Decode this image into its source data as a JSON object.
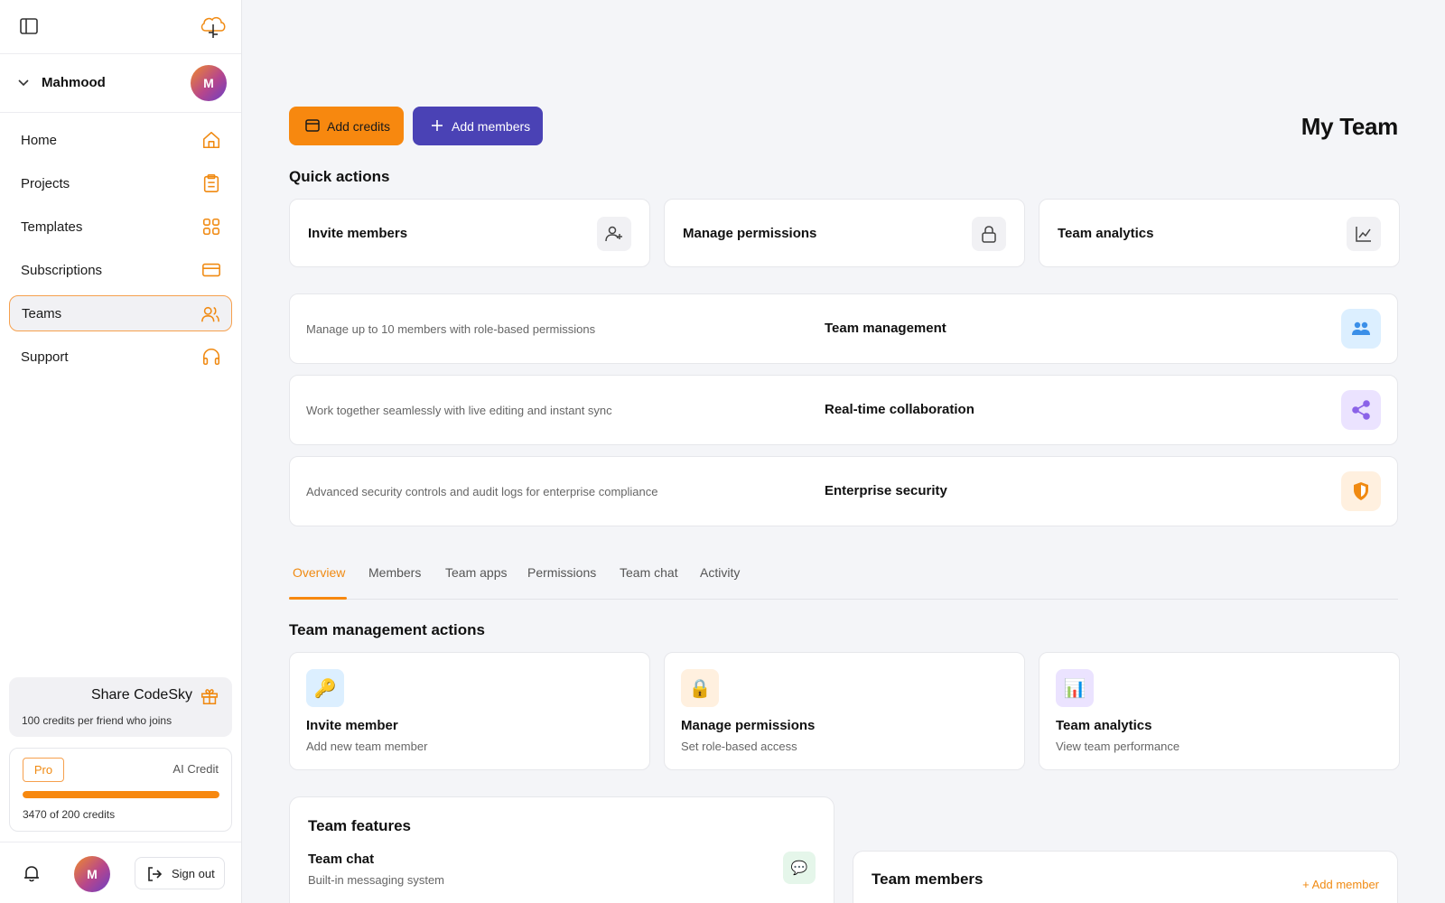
{
  "user": {
    "name": "Mahmood",
    "initial": "M"
  },
  "nav": [
    {
      "label": "Home",
      "icon": "home-icon",
      "active": false
    },
    {
      "label": "Projects",
      "icon": "clipboard-icon",
      "active": false
    },
    {
      "label": "Templates",
      "icon": "grid-icon",
      "active": false
    },
    {
      "label": "Subscriptions",
      "icon": "card-icon",
      "active": false
    },
    {
      "label": "Teams",
      "icon": "users-icon",
      "active": true
    },
    {
      "label": "Support",
      "icon": "headphones-icon",
      "active": false
    }
  ],
  "share": {
    "title": "Share CodeSky",
    "subtitle": "100 credits per friend who joins"
  },
  "credit": {
    "plan": "Pro",
    "label": "AI Credit",
    "text": "3470 of 200 credits",
    "fill_fraction": 1.0
  },
  "signout": {
    "label": "Sign out"
  },
  "toolbar": {
    "add_credits": "Add credits",
    "add_members": "Add members"
  },
  "page": {
    "title": "My Team"
  },
  "quick_actions": {
    "title": "Quick actions",
    "items": [
      {
        "label": "Invite members",
        "icon": "user-plus-icon"
      },
      {
        "label": "Manage permissions",
        "icon": "lock-icon"
      },
      {
        "label": "Team analytics",
        "icon": "chart-line-icon"
      }
    ]
  },
  "features": [
    {
      "desc": "Manage up to 10 members with role-based permissions",
      "title": "Team management",
      "icon": "users-icon",
      "bg": "#dcefff",
      "color": "#3b8fe8"
    },
    {
      "desc": "Work together seamlessly with live editing and instant sync",
      "title": "Real-time collaboration",
      "icon": "share-icon",
      "bg": "#ebe3ff",
      "color": "#8b63e8"
    },
    {
      "desc": "Advanced security controls and audit logs for enterprise compliance",
      "title": "Enterprise security",
      "icon": "shield-icon",
      "bg": "#fff0df",
      "color": "#f08a12"
    }
  ],
  "tabs": [
    "Overview",
    "Members",
    "Team apps",
    "Permissions",
    "Team chat",
    "Activity"
  ],
  "actions": {
    "title": "Team management actions",
    "items": [
      {
        "title": "Invite member",
        "sub": "Add new team member",
        "glyph": "🔑",
        "bg": "#dcefff"
      },
      {
        "title": "Manage permissions",
        "sub": "Set role-based access",
        "glyph": "🔒",
        "bg": "#fff0df"
      },
      {
        "title": "Team analytics",
        "sub": "View team performance",
        "glyph": "📊",
        "bg": "#ebe3ff"
      }
    ]
  },
  "team_features": {
    "title": "Team features",
    "items": [
      {
        "title": "Team chat",
        "sub": "Built-in messaging system",
        "glyph": "💬"
      }
    ]
  },
  "team_members": {
    "title": "Team members",
    "add_label": "+ Add member"
  },
  "colors": {
    "accent": "#f7880f",
    "primary": "#4a42b5"
  }
}
